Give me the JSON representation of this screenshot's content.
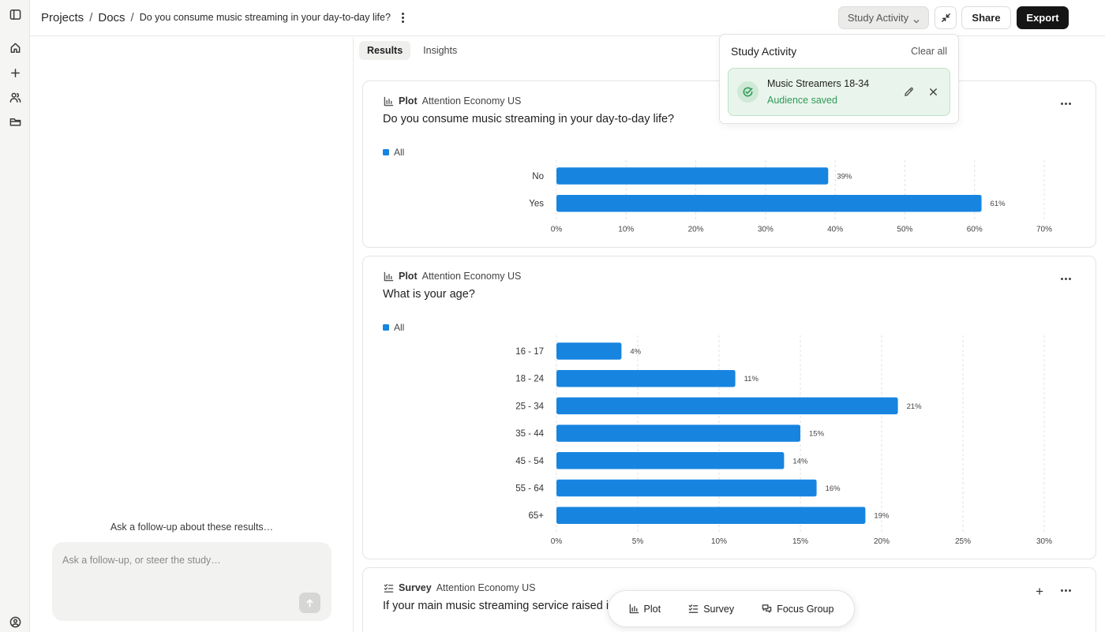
{
  "breadcrumb": {
    "items": [
      "Projects",
      "Docs"
    ],
    "separator": "/",
    "current": "Do you consume music streaming in your day-to-day life?"
  },
  "toolbar": {
    "study_activity_label": "Study Activity",
    "share_label": "Share",
    "export_label": "Export"
  },
  "rail": {
    "icons": [
      "sidebar-toggle-icon",
      "home-icon",
      "plus-icon",
      "users-icon",
      "folder-icon",
      "account-icon"
    ]
  },
  "left_panel": {
    "followup_label": "Ask a follow-up about these results…",
    "input_placeholder": "Ask a follow-up, or steer the study…"
  },
  "tabs": [
    {
      "label": "Results",
      "active": true
    },
    {
      "label": "Insights",
      "active": false
    }
  ],
  "popover": {
    "title": "Study Activity",
    "clear_label": "Clear all",
    "item": {
      "name": "Music Streamers 18-34",
      "status": "Audience saved"
    }
  },
  "colors": {
    "bar": "#1784e0",
    "success": "#2f9a58",
    "export_bg": "#151515"
  },
  "cards": [
    {
      "type_label": "Plot",
      "source": "Attention Economy US",
      "title": "Do you consume music streaming in your day-to-day life?",
      "legend": "All"
    },
    {
      "type_label": "Plot",
      "source": "Attention Economy US",
      "title": "What is your age?",
      "legend": "All"
    },
    {
      "type_label": "Survey",
      "source": "Attention Economy US",
      "title": "If your main music streaming service raised it"
    }
  ],
  "chart_data": [
    {
      "type": "bar",
      "orientation": "horizontal",
      "title": "Do you consume music streaming in your day-to-day life?",
      "categories": [
        "No",
        "Yes"
      ],
      "series": [
        {
          "name": "All",
          "values": [
            39,
            61
          ]
        }
      ],
      "value_labels": [
        "39%",
        "61%"
      ],
      "xlim": [
        0,
        70
      ],
      "xticks": [
        "0%",
        "10%",
        "20%",
        "30%",
        "40%",
        "50%",
        "60%",
        "70%"
      ],
      "grid": true,
      "legend": "top-left"
    },
    {
      "type": "bar",
      "orientation": "horizontal",
      "title": "What is your age?",
      "categories": [
        "16 - 17",
        "18 - 24",
        "25 - 34",
        "35 - 44",
        "45 - 54",
        "55 - 64",
        "65+"
      ],
      "series": [
        {
          "name": "All",
          "values": [
            4,
            11,
            21,
            15,
            14,
            16,
            19
          ]
        }
      ],
      "value_labels": [
        "4%",
        "11%",
        "21%",
        "15%",
        "14%",
        "16%",
        "19%"
      ],
      "xlim": [
        0,
        30
      ],
      "xticks": [
        "0%",
        "5%",
        "10%",
        "15%",
        "20%",
        "25%",
        "30%"
      ],
      "grid": true,
      "legend": "top-left"
    }
  ],
  "addbar": {
    "items": [
      {
        "label": "Plot",
        "icon": "chart-icon"
      },
      {
        "label": "Survey",
        "icon": "checklist-icon"
      },
      {
        "label": "Focus Group",
        "icon": "chat-icon"
      }
    ]
  }
}
